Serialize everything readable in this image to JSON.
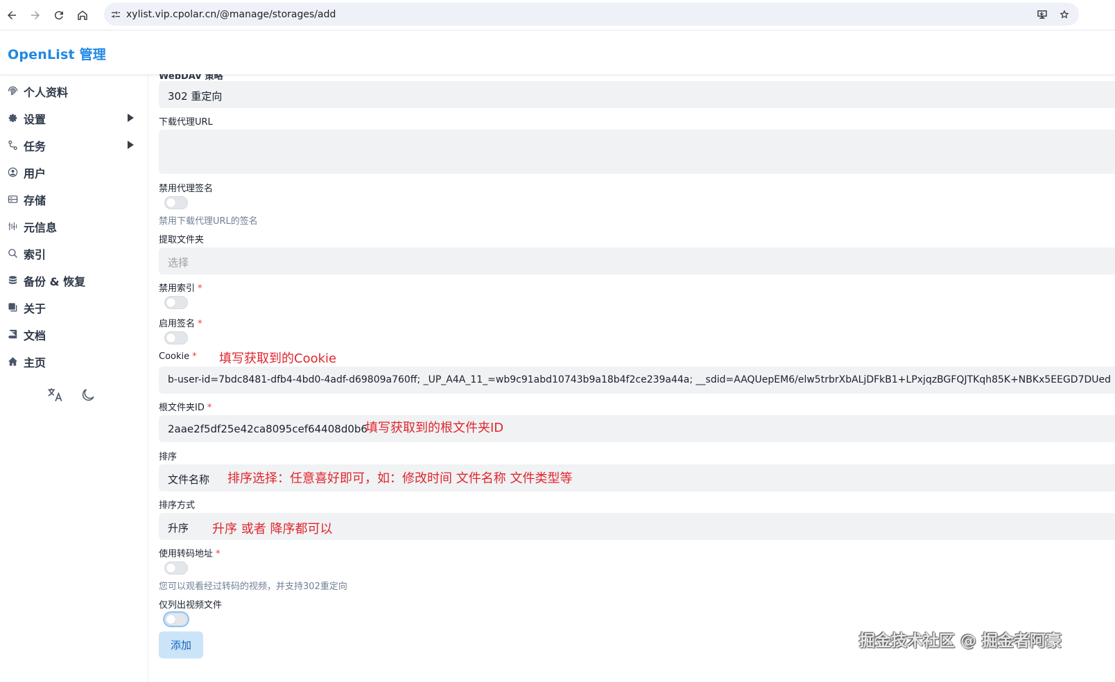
{
  "browser": {
    "url": "xylist.vip.cpolar.cn/@manage/storages/add"
  },
  "app": {
    "title": "OpenList 管理"
  },
  "sidebar": {
    "items": [
      {
        "label": "个人资料",
        "icon": "fingerprint-icon"
      },
      {
        "label": "设置",
        "icon": "gear-icon",
        "expandable": true
      },
      {
        "label": "任务",
        "icon": "route-icon",
        "expandable": true
      },
      {
        "label": "用户",
        "icon": "user-circle-icon"
      },
      {
        "label": "存储",
        "icon": "database-drive-icon"
      },
      {
        "label": "元信息",
        "icon": "meta-grid-icon"
      },
      {
        "label": "索引",
        "icon": "search-icon"
      },
      {
        "label": "备份 & 恢复",
        "icon": "database-icon"
      },
      {
        "label": "关于",
        "icon": "copy-icon"
      },
      {
        "label": "文档",
        "icon": "book-icon"
      },
      {
        "label": "主页",
        "icon": "home-icon"
      }
    ],
    "tools": [
      "translate-icon",
      "moon-icon"
    ]
  },
  "form": {
    "cut_label": "WebDAV 策略",
    "webdav_policy_value": "302 重定向",
    "download_proxy_url_label": "下载代理URL",
    "download_proxy_url_value": "",
    "disable_proxy_sign_label": "禁用代理签名",
    "disable_proxy_sign_help": "禁用下载代理URL的签名",
    "extract_folder_label": "提取文件夹",
    "extract_folder_placeholder": "选择",
    "disable_index_label": "禁用索引",
    "enable_sign_label": "启用签名",
    "cookie_label": "Cookie",
    "cookie_value": "b-user-id=7bdc8481-dfb4-4bd0-4adf-d69809a760ff; _UP_A4A_11_=wb9c91abd10743b9a18b4f2ce239a44a; __sdid=AAQUepEM6/elw5trbrXbALjDFkB1+LPxjqzBGFQJTKqh85K+NBKx5EEGD7DUed",
    "root_folder_id_label": "根文件夹ID",
    "root_folder_id_value": "2aae2f5df25e42ca8095cef64408d0b6",
    "order_by_label": "排序",
    "order_by_value": "文件名称",
    "order_direction_label": "排序方式",
    "order_direction_value": "升序",
    "use_transcoding_label": "使用转码地址",
    "use_transcoding_help": "您可以观看经过转码的视频，并支持302重定向",
    "only_list_video_label": "仅列出视频文件",
    "required_mark": "*",
    "add_button": "添加"
  },
  "annotations": {
    "cookie": "填写获取到的Cookie",
    "root_folder": "填写获取到的根文件夹ID",
    "order_by": "排序选择：任意喜好即可，如：修改时间  文件名称 文件类型等",
    "order_direction": "升序 或者 降序都可以"
  },
  "watermark": "掘金技术社区 @ 掘金者阿豪",
  "colors": {
    "brand": "#1e88e5",
    "annotation": "#e0262c",
    "required": "#e53e3e",
    "field_bg": "#f0f2f4",
    "button_bg": "#cce4f8"
  }
}
